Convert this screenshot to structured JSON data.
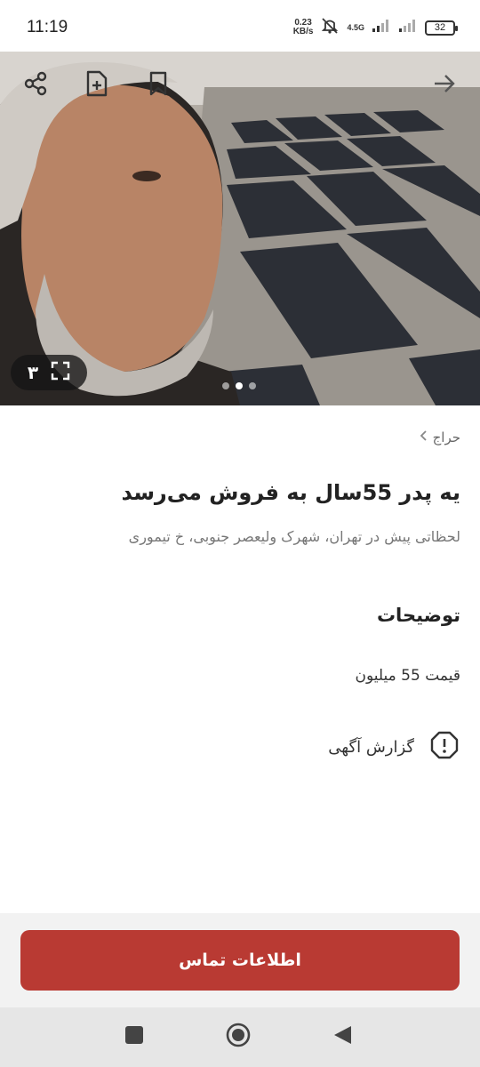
{
  "status_bar": {
    "time": "11:19",
    "net_speed_value": "0.23",
    "net_speed_unit": "KB/s",
    "network_type": "4.5G",
    "battery": "32",
    "icons": [
      "mute-icon",
      "signal-icon",
      "signal-icon",
      "battery-icon"
    ]
  },
  "hero": {
    "image_count": "۳",
    "dots_total": 3,
    "dots_active_index": 0,
    "icons": [
      "share-icon",
      "add-note-icon",
      "bookmark-icon",
      "back-arrow-icon",
      "fullscreen-icon"
    ]
  },
  "listing": {
    "breadcrumb": "حراج",
    "title": "یه پدر 55سال به فروش می‌رسد",
    "subtitle": "لحظاتی پیش در تهران، شهرک ولیعصر جنوبی، خ تیموری",
    "description_heading": "توضیحات",
    "description": "قیمت 55 میلیون",
    "report_label": "گزارش آگهی"
  },
  "actions": {
    "contact_label": "اطلاعات تماس",
    "accent_color": "#b93a33"
  },
  "nav": {
    "icons": [
      "recents-icon",
      "home-icon",
      "back-icon"
    ]
  }
}
